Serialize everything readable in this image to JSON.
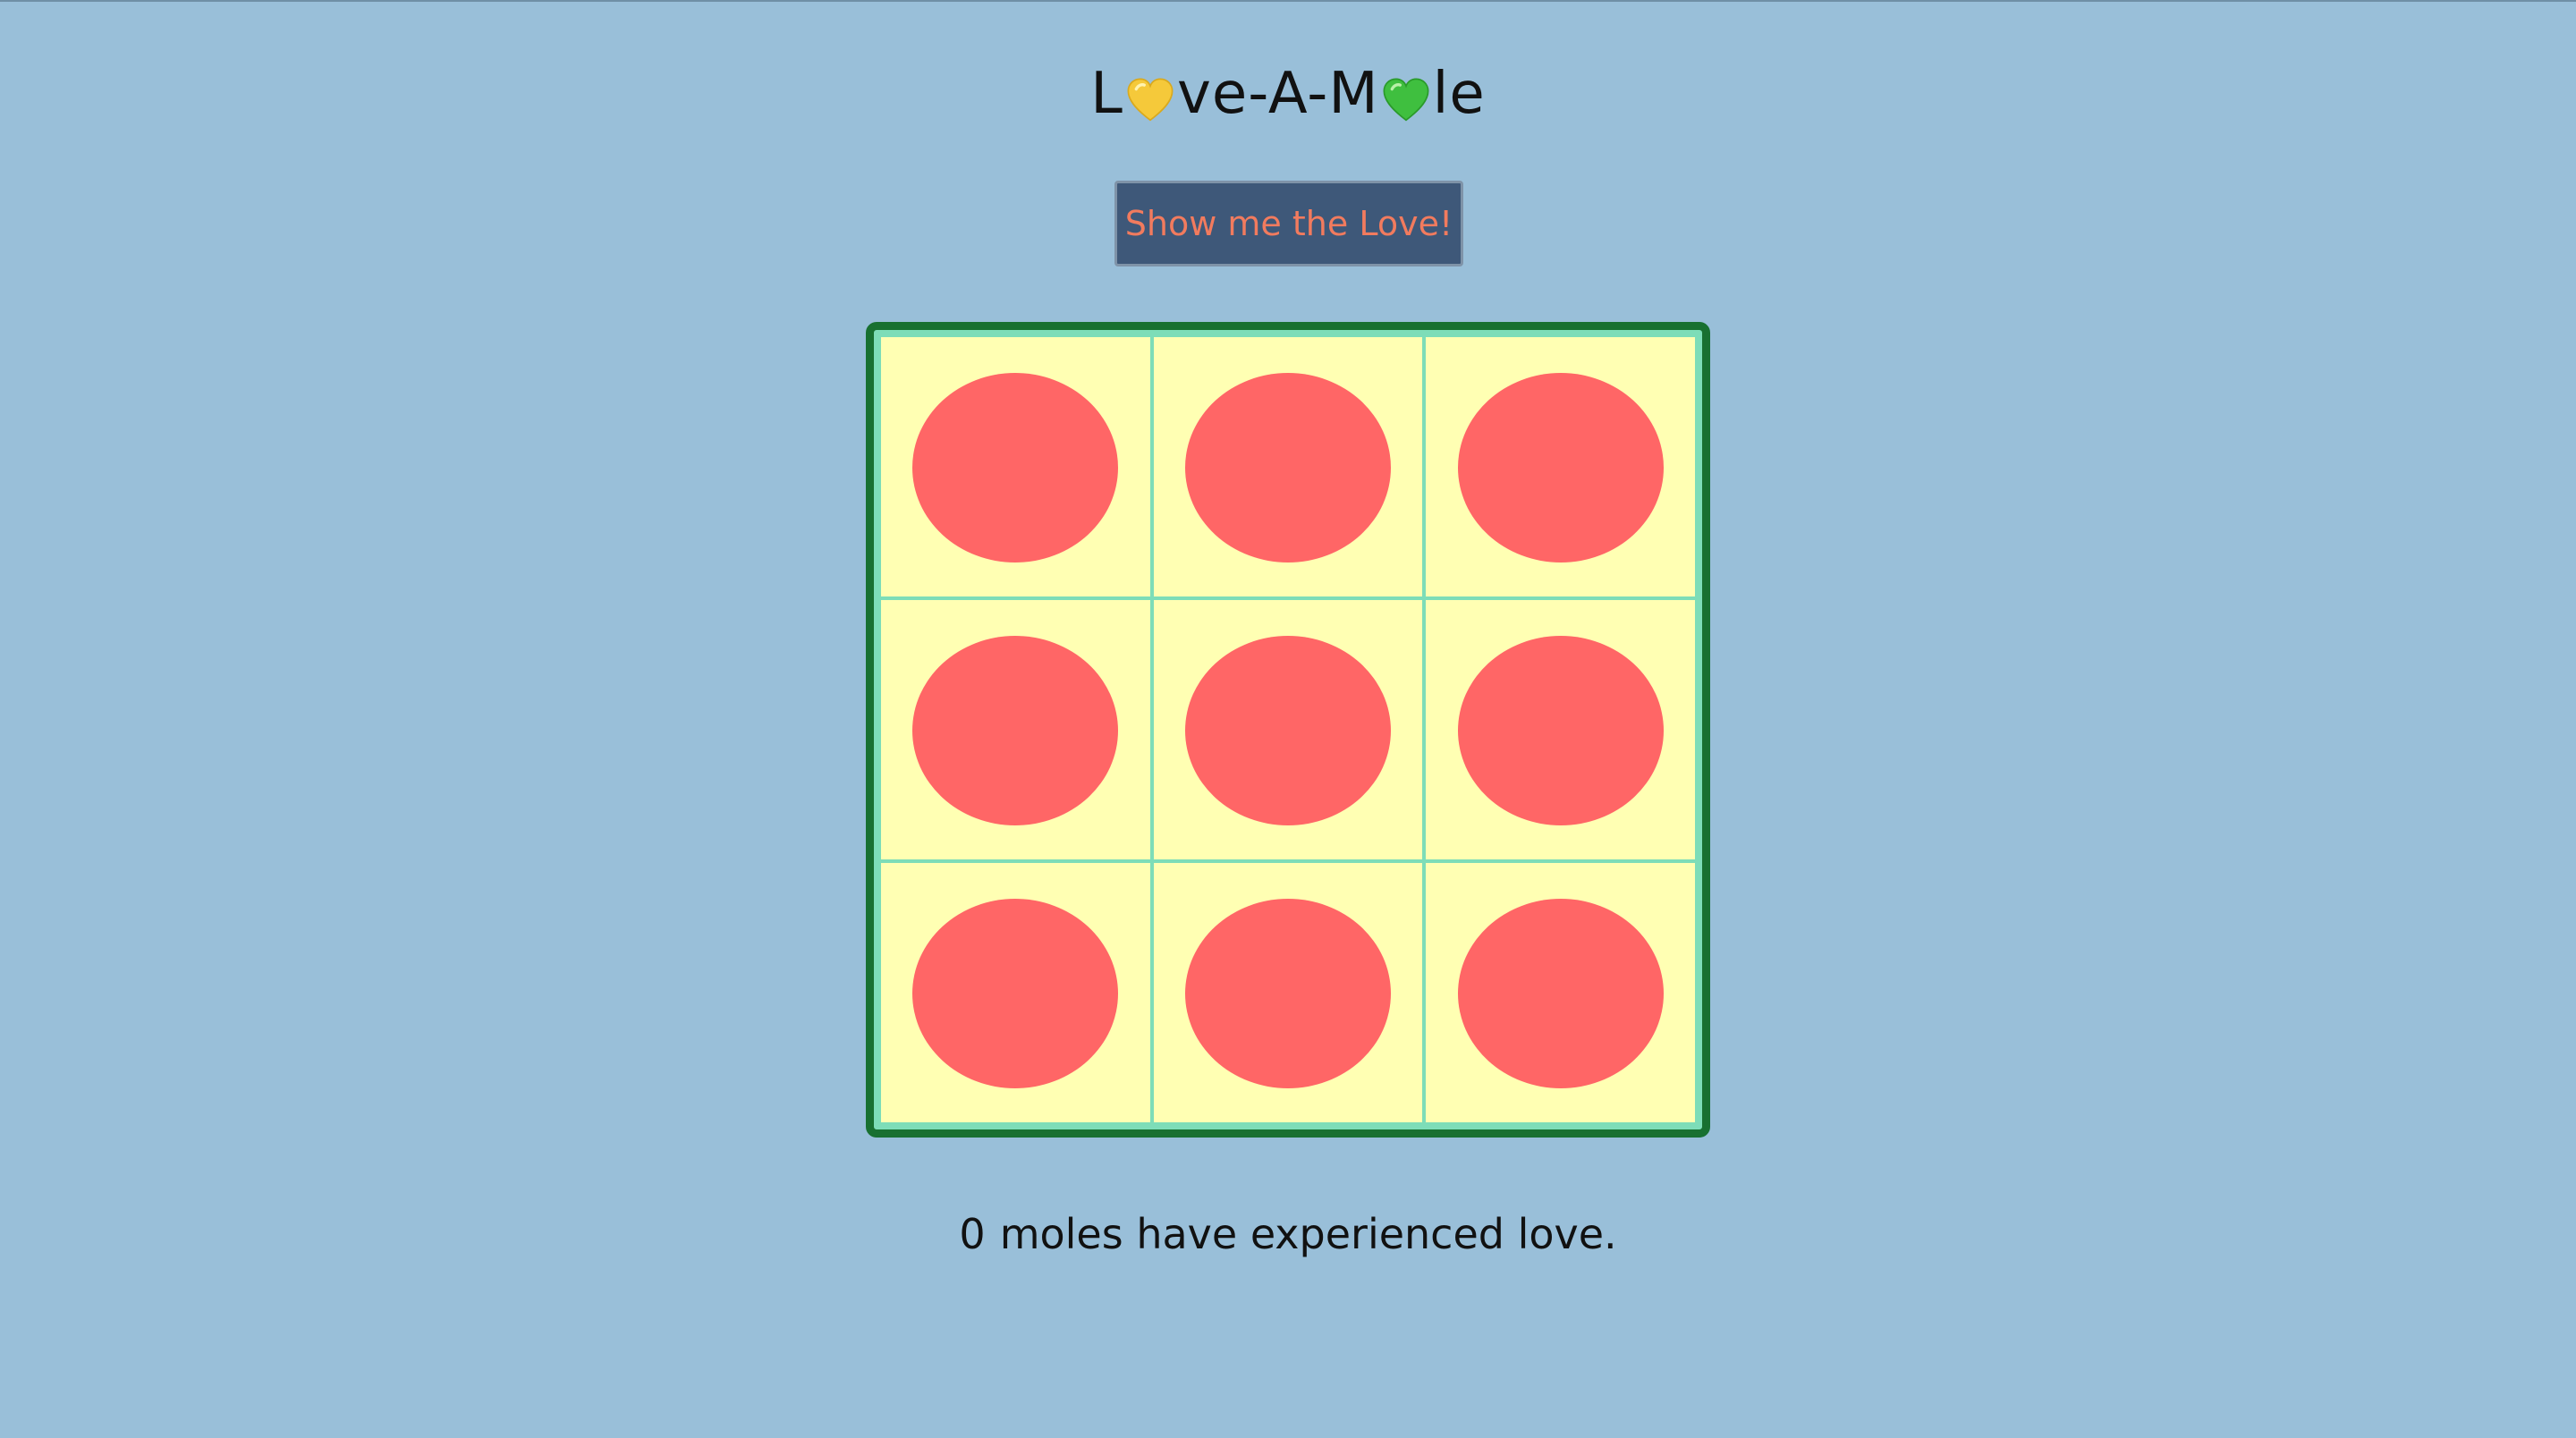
{
  "title": {
    "part1": "L",
    "part2": "ve-A-M",
    "part3": "le",
    "heart1_color": "#f5c93a",
    "heart2_color": "#3fbf3f",
    "heart1_icon": "yellow-heart-icon",
    "heart2_icon": "green-heart-icon"
  },
  "button": {
    "label": "Show me the Love!"
  },
  "board": {
    "cells": [
      {
        "id": 1
      },
      {
        "id": 2
      },
      {
        "id": 3
      },
      {
        "id": 4
      },
      {
        "id": 5
      },
      {
        "id": 6
      },
      {
        "id": 7
      },
      {
        "id": 8
      },
      {
        "id": 9
      }
    ],
    "cell_color": "#ffffb3",
    "hole_color": "#ff6666",
    "border_color": "#187031",
    "grid_line_color": "#7dddb8"
  },
  "status": {
    "count": "0",
    "text": "moles have experienced love."
  },
  "colors": {
    "background": "#99bfd9",
    "button_bg": "#3e5879",
    "button_text": "#f27b5e"
  }
}
